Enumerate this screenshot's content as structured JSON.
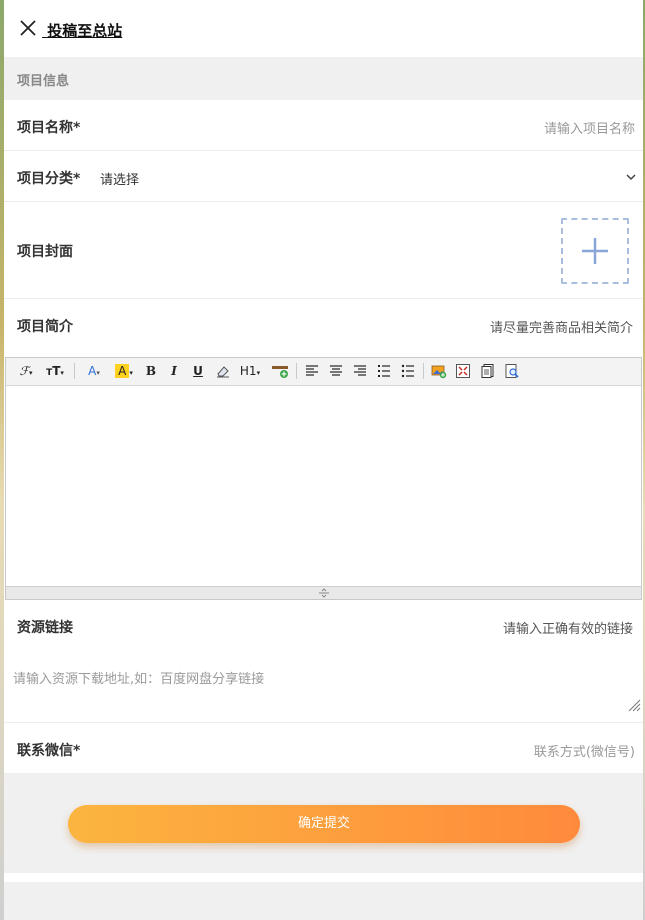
{
  "header": {
    "close_icon": "close-icon",
    "title": " 投稿至总站"
  },
  "section": {
    "title": "项目信息"
  },
  "form": {
    "name": {
      "label": "项目名称*",
      "placeholder": "请输入项目名称"
    },
    "category": {
      "label": "项目分类*",
      "value": "请选择",
      "icon": "chevron-down-icon"
    },
    "cover": {
      "label": "项目封面",
      "icon": "plus-icon"
    },
    "intro": {
      "label": "项目简介",
      "hint": "请尽量完善商品相关简介"
    },
    "resource": {
      "label": "资源链接",
      "hint": "请输入正确有效的链接",
      "placeholder": "请输入资源下载地址,如：百度网盘分享链接"
    },
    "wechat": {
      "label": "联系微信*",
      "placeholder": "联系方式(微信号)"
    }
  },
  "editor": {
    "toolbar": [
      {
        "name": "font-family",
        "label": "ℱ",
        "icon": "font-family-icon"
      },
      {
        "name": "font-size",
        "label": "ᴛT",
        "icon": "font-size-icon"
      },
      {
        "name": "font-color",
        "label": "A",
        "icon": "font-color-icon"
      },
      {
        "name": "highlight",
        "label": "A",
        "icon": "highlight-icon"
      },
      {
        "name": "bold",
        "label": "B",
        "icon": "bold-icon"
      },
      {
        "name": "italic",
        "label": "I",
        "icon": "italic-icon"
      },
      {
        "name": "underline",
        "label": "U",
        "icon": "underline-icon"
      },
      {
        "name": "clear-format",
        "label": "",
        "icon": "eraser-icon"
      },
      {
        "name": "heading",
        "label": "H1",
        "icon": "heading-icon"
      },
      {
        "name": "horizontal-rule",
        "label": "",
        "icon": "horizontal-rule-icon"
      },
      {
        "name": "align-left",
        "label": "",
        "icon": "align-left-icon"
      },
      {
        "name": "align-center",
        "label": "",
        "icon": "align-center-icon"
      },
      {
        "name": "align-right",
        "label": "",
        "icon": "align-right-icon"
      },
      {
        "name": "ordered-list",
        "label": "",
        "icon": "ordered-list-icon"
      },
      {
        "name": "unordered-list",
        "label": "",
        "icon": "unordered-list-icon"
      },
      {
        "name": "insert-image",
        "label": "",
        "icon": "insert-image-icon"
      },
      {
        "name": "fullscreen",
        "label": "",
        "icon": "fullscreen-icon"
      },
      {
        "name": "source",
        "label": "",
        "icon": "source-icon"
      },
      {
        "name": "preview",
        "label": "",
        "icon": "preview-icon"
      }
    ]
  },
  "footer": {
    "submit_label": "确定提交"
  },
  "colors": {
    "accent_start": "#fbb53f",
    "accent_end": "#ff8a3c",
    "upload_border": "#a9bde0"
  }
}
